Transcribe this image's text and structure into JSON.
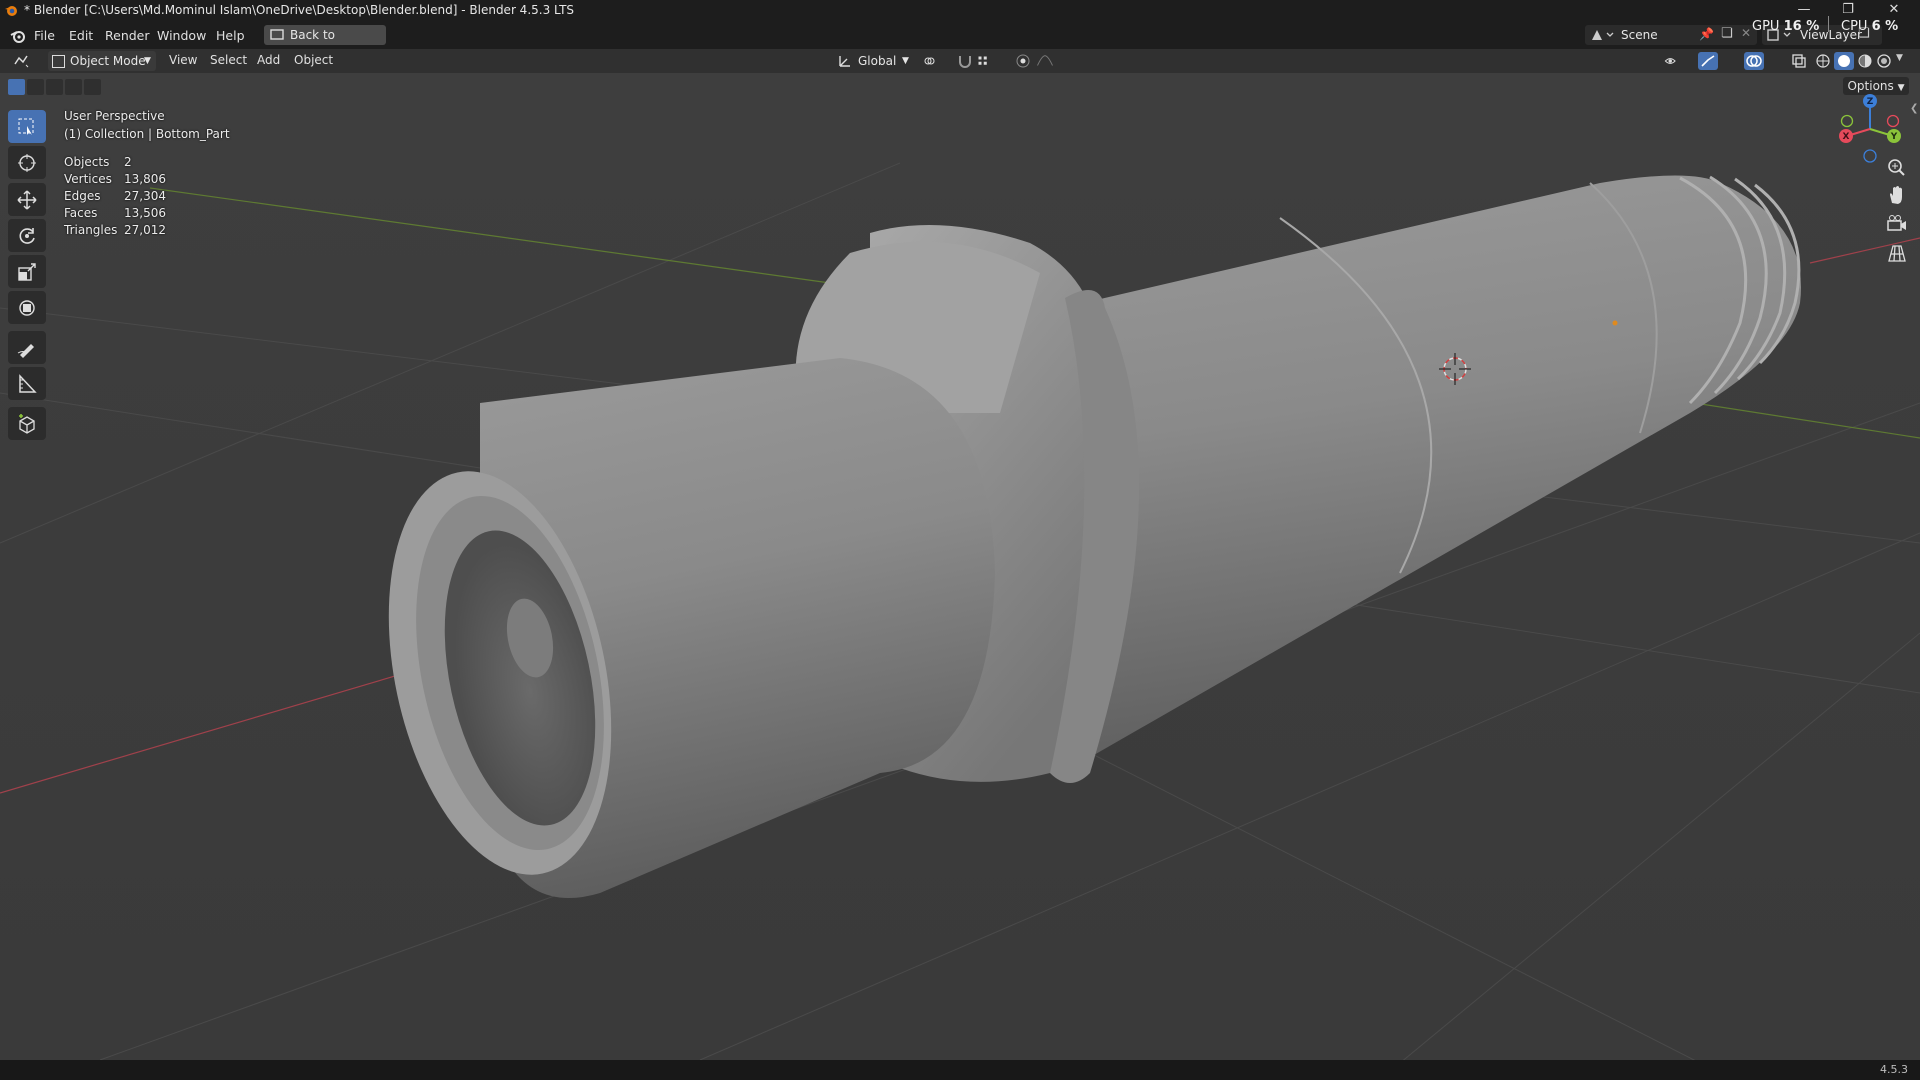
{
  "window": {
    "title": "* Blender [C:\\Users\\Md.Mominul Islam\\OneDrive\\Desktop\\Blender.blend] - Blender 4.5.3 LTS",
    "minimize_icon": "minimize-icon",
    "maximize_icon": "restore-icon",
    "close_icon": "close-icon"
  },
  "menu": {
    "items": [
      "File",
      "Edit",
      "Render",
      "Window",
      "Help"
    ],
    "back_button": "Back to Previous",
    "scene": "Scene",
    "view_layer": "ViewLayer",
    "gpu_label": "GPU",
    "gpu_value": "16 %",
    "cpu_label": "CPU",
    "cpu_value": "6 %"
  },
  "header": {
    "mode": "Object Mode",
    "menus": [
      "View",
      "Select",
      "Add",
      "Object"
    ],
    "transform_orientation": "Global"
  },
  "viewport": {
    "options_label": "Options",
    "perspective": "User Perspective",
    "collection": "(1) Collection | Bottom_Part",
    "stats": [
      {
        "label": "Objects",
        "value": "2"
      },
      {
        "label": "Vertices",
        "value": "13,806"
      },
      {
        "label": "Edges",
        "value": "27,304"
      },
      {
        "label": "Faces",
        "value": "13,506"
      },
      {
        "label": "Triangles",
        "value": "27,012"
      }
    ],
    "gizmo_axes": {
      "x": "X",
      "y": "Y",
      "z": "Z"
    },
    "axis_colors": {
      "x": "#e64a5b",
      "y": "#8bc43a",
      "z": "#3c7fd9"
    }
  },
  "toolbar": {
    "tools": [
      "select-box-icon",
      "cursor-icon",
      "move-icon",
      "rotate-icon",
      "scale-icon",
      "transform-icon",
      "annotate-icon",
      "measure-icon",
      "add-cube-icon"
    ]
  },
  "statusbar": {
    "version": "4.5.3"
  }
}
